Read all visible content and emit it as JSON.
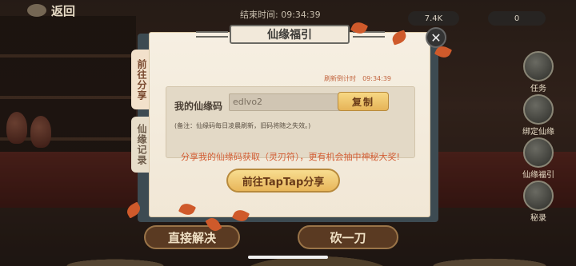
{
  "topbar": {
    "back_label": "返回",
    "end_time": "结束时间: 09:34:39",
    "resource_a": "7.4K",
    "resource_b": "0"
  },
  "side_menu": [
    {
      "label": "任务"
    },
    {
      "label": "绑定仙缘"
    },
    {
      "label": "仙缘福引"
    },
    {
      "label": "秘录"
    }
  ],
  "bottom_buttons": {
    "left": "直接解决",
    "right": "砍一刀"
  },
  "dialog": {
    "title": "仙缘福引",
    "tabs": [
      "前往分享",
      "仙缘记录"
    ],
    "countdown_label": "刷新倒计时",
    "countdown_value": "09:34:39",
    "code_label": "我的仙缘码",
    "code_value": "edlvo2",
    "copy_label": "复制",
    "note": "(备注：仙缘码每日凌晨刷新，旧码将随之失效。)",
    "promo": "分享我的仙缘码获取（灵刃符），更有机会抽中神秘大奖!",
    "share_button": "前往TapTap分享"
  },
  "colors": {
    "accent": "#d35e35",
    "button_gold": "#e8b65a",
    "dialog_bg": "#f6efe2"
  }
}
